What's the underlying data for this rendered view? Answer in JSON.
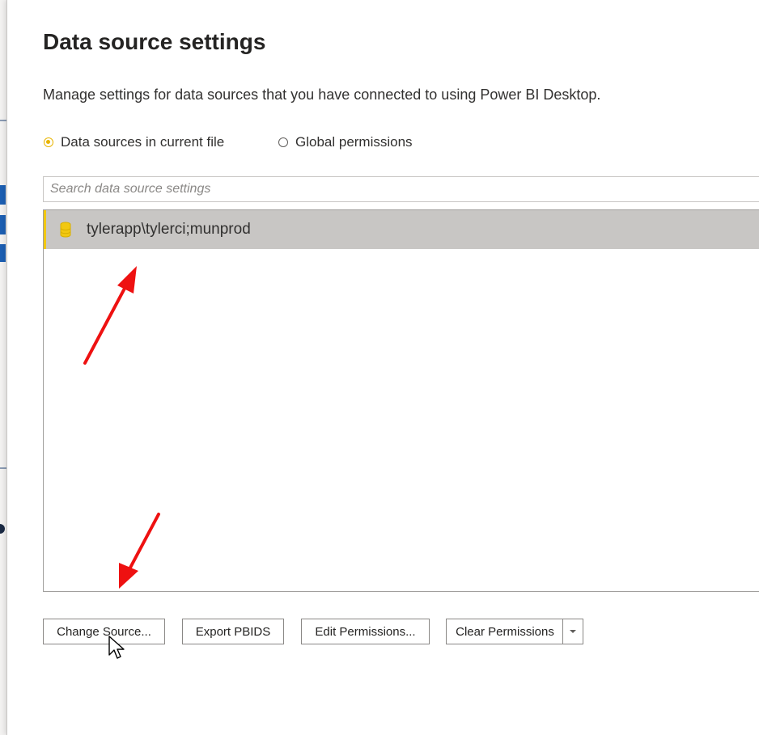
{
  "dialog": {
    "title": "Data source settings",
    "description": "Manage settings for data sources that you have connected to using Power BI Desktop."
  },
  "scope": {
    "options": [
      {
        "label": "Data sources in current file",
        "selected": true
      },
      {
        "label": "Global permissions",
        "selected": false
      }
    ]
  },
  "search": {
    "placeholder": "Search data source settings",
    "value": ""
  },
  "sources": {
    "items": [
      {
        "label": "tylerapp\\tylerci;munprod",
        "icon": "database-icon",
        "selected": true
      }
    ]
  },
  "buttons": {
    "change_source": "Change Source...",
    "export_pbids": "Export PBIDS",
    "edit_permissions": "Edit Permissions...",
    "clear_permissions": "Clear Permissions"
  },
  "colors": {
    "accent": "#F2C811",
    "selected_row": "#C8C6C4",
    "annotation_arrow": "#EE1111"
  }
}
